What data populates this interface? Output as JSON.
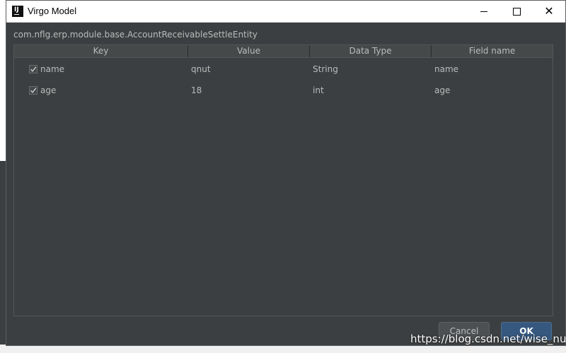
{
  "window": {
    "title": "Virgo Model",
    "minimize_label": "",
    "maximize_label": "",
    "close_label": "✕"
  },
  "class_path": "com.nflg.erp.module.base.AccountReceivableSettleEntity",
  "table": {
    "headers": [
      "Key",
      "Value",
      "Data Type",
      "Field name"
    ],
    "rows": [
      {
        "checked": true,
        "key": "name",
        "value": "qnut",
        "type": "String",
        "field": "name"
      },
      {
        "checked": true,
        "key": "age",
        "value": "18",
        "type": "int",
        "field": "age"
      }
    ]
  },
  "buttons": {
    "cancel": "Cancel",
    "ok": "OK"
  },
  "watermark": "https://blog.csdn.net/wise_nut",
  "colors": {
    "background": "#3c3f41",
    "text": "#bbbbbb",
    "ok_button": "#365880"
  }
}
